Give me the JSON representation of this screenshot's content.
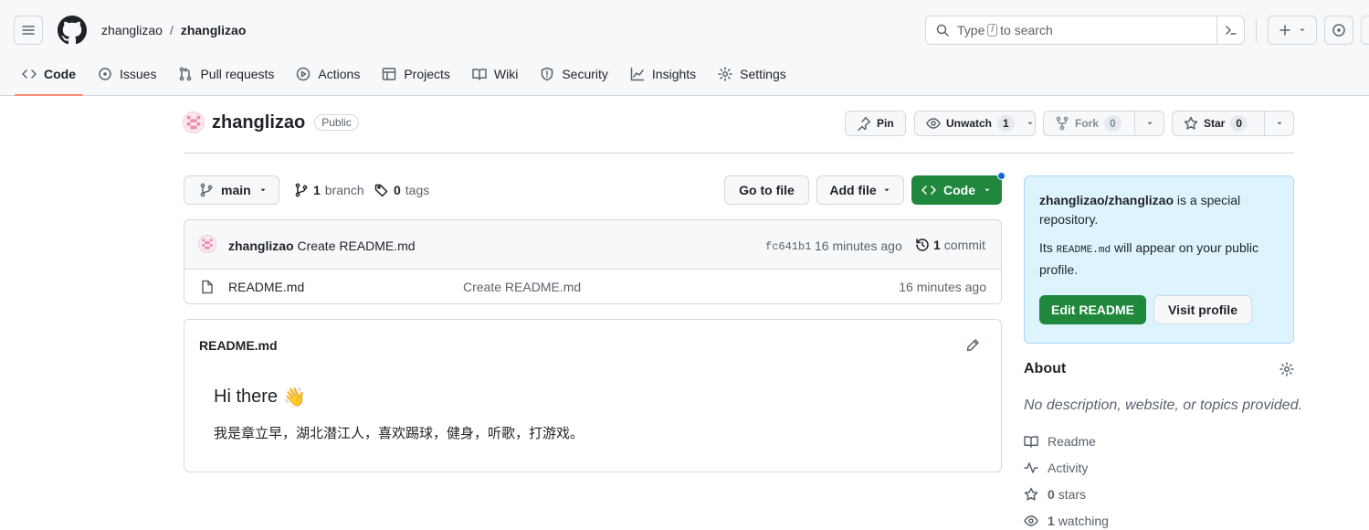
{
  "header": {
    "owner": "zhanglizao",
    "separator": "/",
    "repo": "zhanglizao",
    "search_prefix": "Type",
    "search_key": "/",
    "search_suffix": "to search"
  },
  "tabs": [
    {
      "label": "Code",
      "icon": "code-icon",
      "active": true
    },
    {
      "label": "Issues",
      "icon": "issue-icon"
    },
    {
      "label": "Pull requests",
      "icon": "pull-request-icon"
    },
    {
      "label": "Actions",
      "icon": "play-icon"
    },
    {
      "label": "Projects",
      "icon": "table-icon"
    },
    {
      "label": "Wiki",
      "icon": "book-icon"
    },
    {
      "label": "Security",
      "icon": "shield-icon"
    },
    {
      "label": "Insights",
      "icon": "graph-icon"
    },
    {
      "label": "Settings",
      "icon": "gear-icon"
    }
  ],
  "repo": {
    "name": "zhanglizao",
    "visibility": "Public",
    "pin_label": "Pin",
    "unwatch_label": "Unwatch",
    "watch_count": "1",
    "fork_label": "Fork",
    "fork_count": "0",
    "star_label": "Star",
    "star_count": "0"
  },
  "filenav": {
    "branch": "main",
    "branch_count": "1",
    "branch_label": "branch",
    "tag_count": "0",
    "tag_label": "tags",
    "go_to_file": "Go to file",
    "add_file": "Add file",
    "code": "Code"
  },
  "commit": {
    "author": "zhanglizao",
    "message": "Create README.md",
    "sha": "fc641b1",
    "time": "16 minutes ago",
    "count": "1",
    "count_label": "commit"
  },
  "files": [
    {
      "name": "README.md",
      "message": "Create README.md",
      "age": "16 minutes ago"
    }
  ],
  "readme": {
    "title": "README.md",
    "heading": "Hi there",
    "emoji": "👋",
    "body": "我是章立早，湖北潜江人，喜欢踢球，健身，听歌，打游戏。"
  },
  "sidebar": {
    "special_repo": "zhanglizao/zhanglizao",
    "special_text1": "is a special repository.",
    "special_text2a": "Its",
    "special_code": "README.md",
    "special_text2b": "will appear on your public profile.",
    "edit_readme": "Edit README",
    "visit_profile": "Visit profile",
    "about_title": "About",
    "about_desc": "No description, website, or topics provided.",
    "items": [
      {
        "label": "Readme",
        "icon": "book-icon"
      },
      {
        "label": "Activity",
        "icon": "pulse-icon"
      },
      {
        "count": "0",
        "label": "stars",
        "icon": "star-icon"
      },
      {
        "count": "1",
        "label": "watching",
        "icon": "eye-icon"
      }
    ]
  },
  "colors": {
    "primary_green": "#1f883d",
    "active_tab_underline": "#fd8c73",
    "callout_bg": "#ddf4ff",
    "notification_dot": "#0969da"
  }
}
